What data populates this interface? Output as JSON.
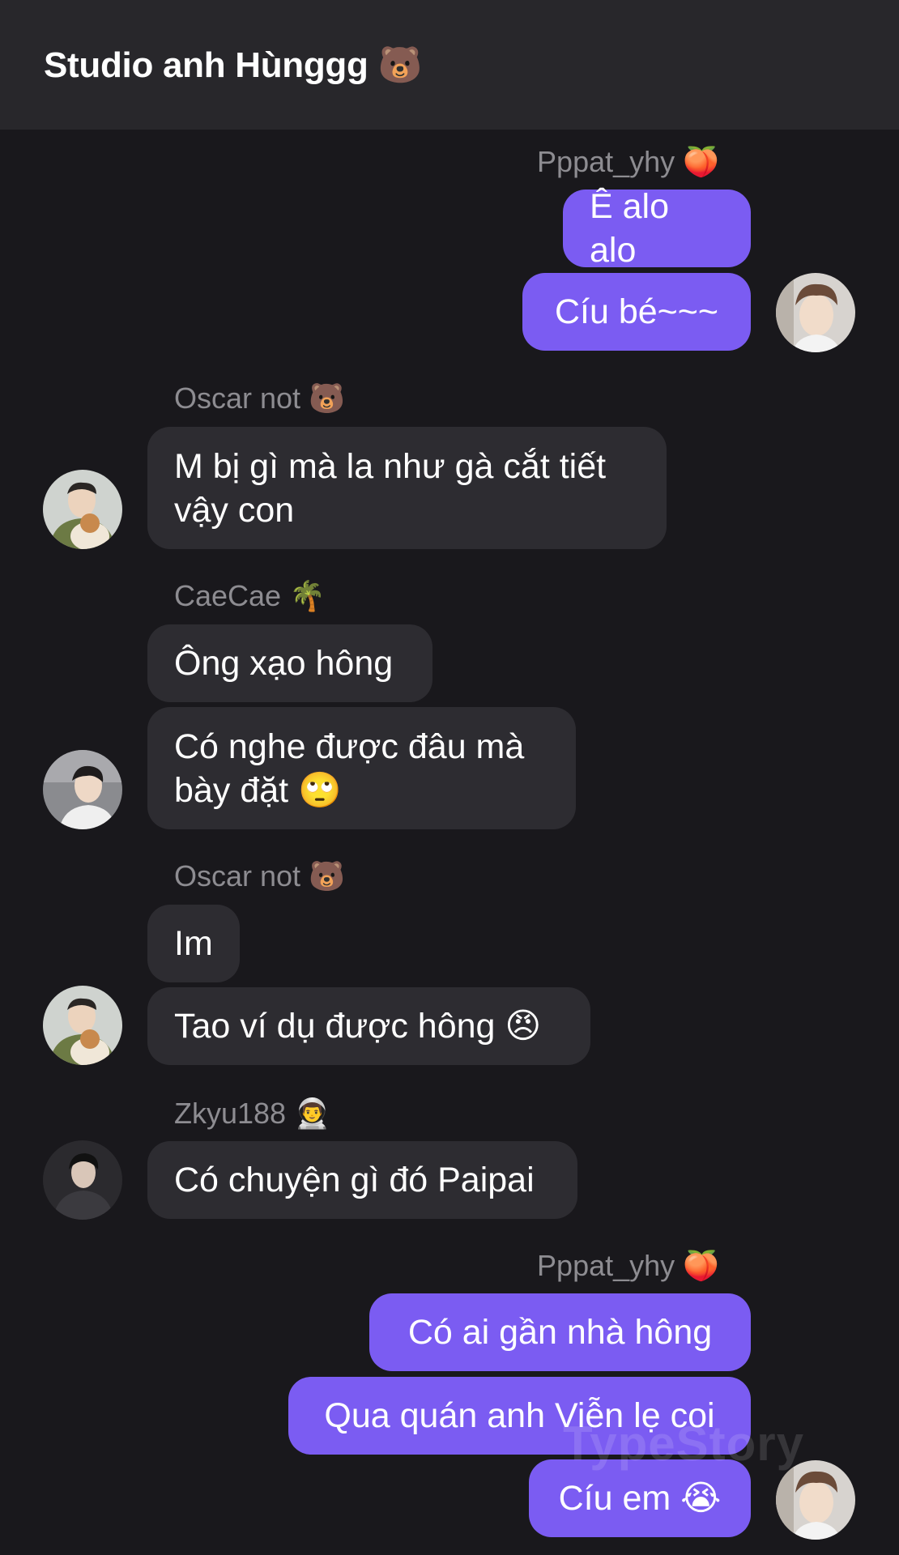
{
  "chat": {
    "title": "Studio anh Hùnggg 🐻"
  },
  "messages": [
    {
      "sender": "Pppat_yhy 🍑",
      "side": "outgoing",
      "texts": [
        "Ê alo alo",
        "Cíu bé~~~"
      ]
    },
    {
      "sender": "Oscar not 🐻",
      "side": "incoming",
      "texts": [
        "M bị gì mà la như gà cắt tiết vậy con"
      ]
    },
    {
      "sender": "CaeCae 🌴",
      "side": "incoming",
      "texts": [
        "Ông xạo hông",
        "Có nghe được đâu mà bày đặt 🙄"
      ]
    },
    {
      "sender": "Oscar not 🐻",
      "side": "incoming",
      "texts": [
        "Im",
        "Tao ví dụ được hông 😠"
      ]
    },
    {
      "sender": "Zkyu188 👨‍🚀",
      "side": "incoming",
      "texts": [
        "Có chuyện gì đó Paipai"
      ]
    },
    {
      "sender": "Pppat_yhy 🍑",
      "side": "outgoing",
      "texts": [
        "Có ai gần nhà hông",
        "Qua quán anh Viễn lẹ coi",
        "Cíu em 😭"
      ]
    }
  ],
  "watermark": "TypeStory",
  "colors": {
    "background": "#19181c",
    "header": "#28272b",
    "incoming_bubble": "#2d2c31",
    "outgoing_bubble": "#7b5cf2",
    "sender_name": "#8d8c91"
  }
}
